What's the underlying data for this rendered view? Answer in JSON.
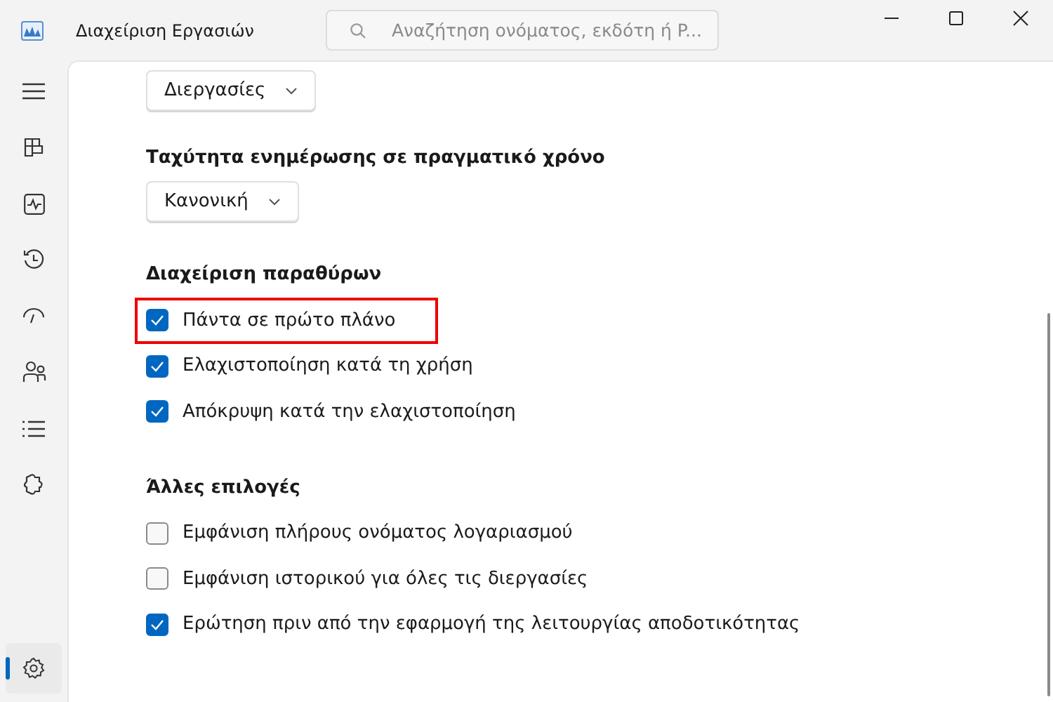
{
  "window": {
    "title": "Διαχείριση Εργασιών"
  },
  "search": {
    "placeholder": "Αναζήτηση ονόματος, εκδότη ή P..."
  },
  "sidebar": {
    "items": [
      {
        "kind": "menu",
        "selected": false
      },
      {
        "kind": "processes",
        "selected": false
      },
      {
        "kind": "performance",
        "selected": false
      },
      {
        "kind": "history",
        "selected": false
      },
      {
        "kind": "startup",
        "selected": false
      },
      {
        "kind": "users",
        "selected": false
      },
      {
        "kind": "details",
        "selected": false
      },
      {
        "kind": "services",
        "selected": false
      },
      {
        "kind": "settings",
        "selected": true
      }
    ]
  },
  "top_dropdown": {
    "value": "Διεργασίες"
  },
  "sections": [
    {
      "heading": "Ταχύτητα ενημέρωσης σε πραγματικό χρόνο",
      "kind": "dropdown",
      "value": "Κανονική"
    },
    {
      "heading": "Διαχείριση παραθύρων",
      "kind": "checkboxes",
      "options": [
        {
          "label": "Πάντα σε πρώτο πλάνο",
          "checked": true,
          "highlighted": true
        },
        {
          "label": "Ελαχιστοποίηση κατά τη χρήση",
          "checked": true,
          "highlighted": false
        },
        {
          "label": "Απόκρυψη κατά την ελαχιστοποίηση",
          "checked": true,
          "highlighted": false
        }
      ]
    },
    {
      "heading": "Άλλες επιλογές",
      "kind": "checkboxes",
      "options": [
        {
          "label": "Εμφάνιση πλήρους ονόματος λογαριασμού",
          "checked": false,
          "highlighted": false
        },
        {
          "label": "Εμφάνιση ιστορικού για όλες τις διεργασίες",
          "checked": false,
          "highlighted": false
        },
        {
          "label": "Ερώτηση πριν από την εφαρμογή της λειτουργίας αποδοτικότητας",
          "checked": true,
          "highlighted": false
        }
      ]
    }
  ]
}
